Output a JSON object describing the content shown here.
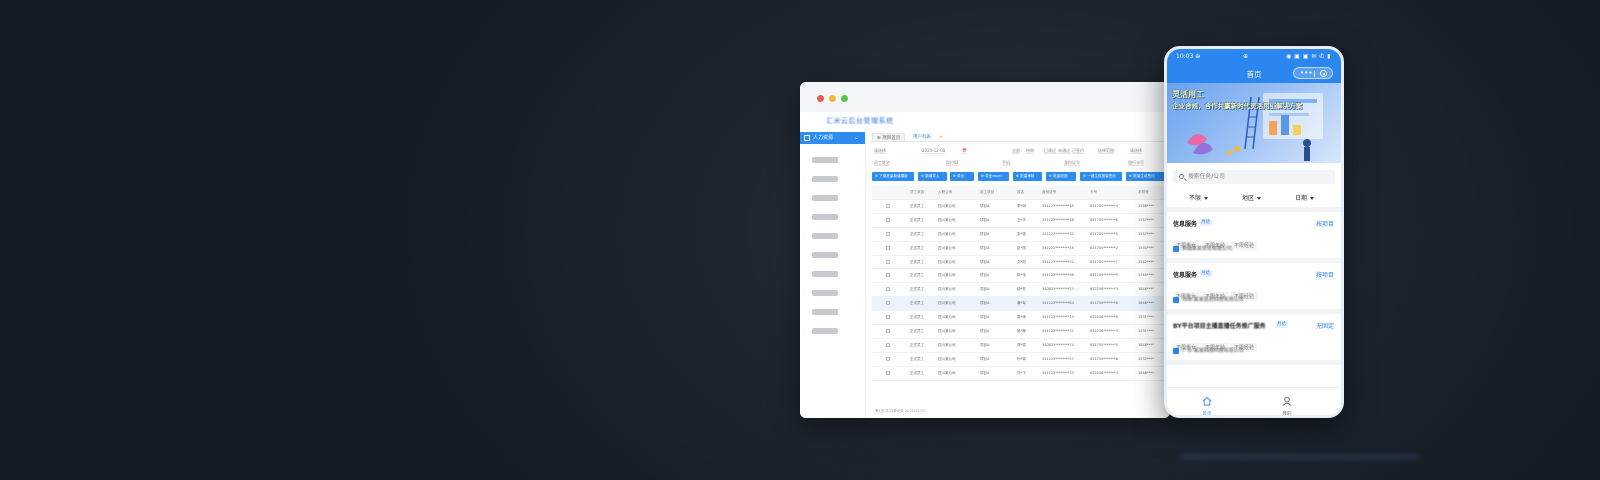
{
  "desktop": {
    "brand": "汇米云后台管理系统",
    "sidebar_active": "人力资源",
    "sidebar_placeholder_count": 10,
    "tabs": {
      "first": "⊕ 项目首页",
      "second": "用户列表",
      "add": "+"
    },
    "filters": {
      "row1": [
        "请选择",
        "2020-12-08",
        "📅",
        "全部",
        "待审",
        "已通过",
        "未通过",
        "已签约",
        "选择范围",
        "请选择"
      ],
      "row2": [
        "员工姓名",
        "用户ID",
        "手机",
        "身份证号",
        "银行卡号"
      ]
    },
    "buttons": [
      "⊕ 下载批量新增模板",
      "⊕ 新增导入",
      "⊕ 导出",
      "⊕ 导出excel",
      "⊕ 批量审核",
      "⊕ 批量驳回",
      "⊕ 一键生成批量签约",
      "⊕ 批量生成签约"
    ],
    "table": {
      "headers": [
        "",
        "员工状态",
        "入职公司",
        "用工项目",
        "姓名",
        "身份证号",
        "卡号",
        "手机号"
      ],
      "rows": [
        [
          "正式员工",
          "四川某公司",
          "项目A",
          "李*明",
          "341123********45",
          "621700*******4",
          "1556****"
        ],
        [
          "正式员工",
          "四川某公司",
          "项目A",
          "王*华",
          "341123********78",
          "621700*******6",
          "1557****"
        ],
        [
          "正式员工",
          "四川某公司",
          "项目A",
          "张*强",
          "341123********32",
          "621700*******5",
          "1557****"
        ],
        [
          "正式员工",
          "四川某公司",
          "项目A",
          "赵*丽",
          "342222********16",
          "621700*******2",
          "1590****"
        ],
        [
          "正式员工",
          "四川某公司",
          "项目A",
          "刘*阳",
          "341123********52",
          "621700*******7",
          "1562****"
        ],
        [
          "正式员工",
          "四川某公司",
          "项目A",
          "陈*伟",
          "341123********98",
          "621700*******9",
          "1749****"
        ],
        [
          "正式员工",
          "四川某公司",
          "项目A",
          "杨*芳",
          "340821********23",
          "622208*******3",
          "1846****"
        ],
        [
          "正式员工",
          "四川某公司",
          "项目A",
          "黄*军",
          "341123********64",
          "621700*******8",
          "1846****"
        ],
        [
          "正式员工",
          "四川某公司",
          "项目A",
          "周*涛",
          "341123********10",
          "622208*******6",
          "1531****"
        ],
        [
          "正式员工",
          "四川某公司",
          "项目A",
          "吴*静",
          "341123********31",
          "622208*******3",
          "1531****"
        ],
        [
          "正式员工",
          "四川某公司",
          "项目A",
          "郑*斌",
          "340821********74",
          "621700*******5",
          "1848****"
        ],
        [
          "正式员工",
          "四川某公司",
          "项目A",
          "孙*娟",
          "341123********57",
          "621700*******8",
          "1532****"
        ],
        [
          "正式员工",
          "四川某公司",
          "项目A",
          "马*飞",
          "341123********33",
          "622208*******4",
          "1848****"
        ]
      ],
      "highlight_row": 7
    },
    "footer": "第1页 共15条记录 2021/12/23"
  },
  "phone": {
    "status": {
      "time": "10:03 ⊕",
      "mid": "⊕",
      "icons": "◉ ▣ ▣ ✉ ✆ ▮"
    },
    "nav_title": "首页",
    "capsule_more": "•••",
    "banner": {
      "headline": "灵活用工",
      "sub": "企业合规，合作共赢新时代灵活用工解决方案"
    },
    "search_placeholder": "搜索任务/公司",
    "dropdowns": [
      "不限",
      "地区",
      "日期"
    ],
    "jobs": [
      {
        "title": "信息服务",
        "tag": "月结",
        "action": "按项目",
        "chips": [
          "不限男女",
          "不限年龄",
          "不限经验"
        ],
        "company": "新疆某某劳务有限公司"
      },
      {
        "title": "信息服务",
        "tag": "月结",
        "action": "按项目",
        "chips": [
          "不限男女",
          "不限年龄",
          "不限经验"
        ],
        "company": "河南·某某信息科技有限公司"
      },
      {
        "title": "BY平台项目主播直播任务推广服务",
        "tag": "月结",
        "action": "无固定",
        "chips": [
          "不限男女",
          "不限年龄",
          "不限经验"
        ],
        "company": "广东·某某网络科技有限公司"
      }
    ],
    "tabbar": {
      "home": "首页",
      "me": "我的"
    }
  },
  "colors": {
    "accent": "#2b86ef",
    "admin_accent": "#2d8cf0",
    "background": "#1e2731"
  }
}
